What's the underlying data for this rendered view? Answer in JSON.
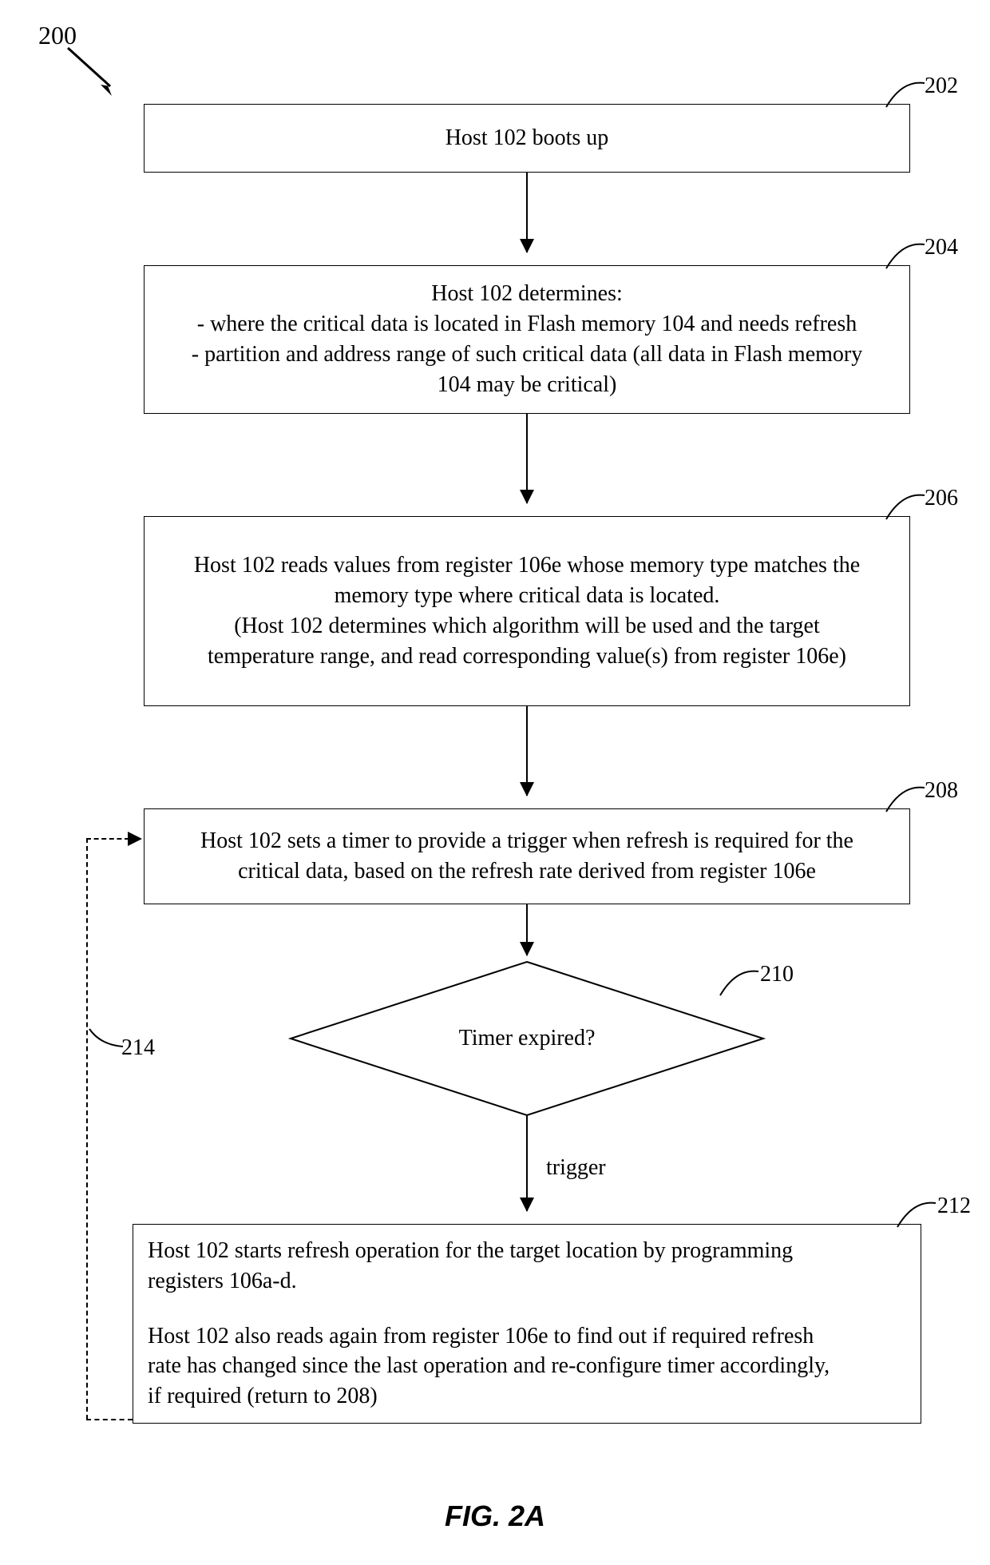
{
  "ref_label": "200",
  "figure_title": "FIG. 2A",
  "steps": {
    "s202": {
      "num": "202",
      "text": "Host 102 boots up"
    },
    "s204": {
      "num": "204",
      "l1": "Host 102 determines:",
      "l2": "- where the critical data is located in Flash memory 104 and needs refresh",
      "l3": "- partition and address range of such critical data (all data in Flash memory",
      "l4": "104 may be critical)"
    },
    "s206": {
      "num": "206",
      "l1": "Host 102 reads values from register 106e whose memory type matches the",
      "l2": "memory type where critical data is located.",
      "l3": "(Host 102 determines which algorithm will be used and the target",
      "l4": "temperature range, and read corresponding value(s) from register 106e)"
    },
    "s208": {
      "num": "208",
      "l1": "Host 102 sets a timer to provide a trigger when refresh is required for the",
      "l2": "critical data, based on the refresh rate derived from register 106e"
    },
    "s210": {
      "num": "210",
      "text": "Timer expired?"
    },
    "s212": {
      "num": "212",
      "l1": "Host 102 starts refresh operation for the target location by programming",
      "l2": "registers 106a-d.",
      "l3": "Host 102 also reads again from register 106e to find out if required refresh",
      "l4": "rate has changed since the last operation and re-configure timer accordingly,",
      "l5": "if required (return to 208)"
    },
    "s214": {
      "num": "214"
    }
  },
  "edge": {
    "trigger": "trigger"
  },
  "chart_data": {
    "type": "flowchart",
    "title": "FIG. 2A",
    "ref_number": "200",
    "nodes": [
      {
        "id": "202",
        "type": "process",
        "text": "Host 102 boots up"
      },
      {
        "id": "204",
        "type": "process",
        "text": "Host 102 determines: where the critical data is located in Flash memory 104 and needs refresh; partition and address range of such critical data (all data in Flash memory 104 may be critical)"
      },
      {
        "id": "206",
        "type": "process",
        "text": "Host 102 reads values from register 106e whose memory type matches the memory type where critical data is located. (Host 102 determines which algorithm will be used and the target temperature range, and read corresponding value(s) from register 106e)"
      },
      {
        "id": "208",
        "type": "process",
        "text": "Host 102 sets a timer to provide a trigger when refresh is required for the critical data, based on the refresh rate derived from register 106e"
      },
      {
        "id": "210",
        "type": "decision",
        "text": "Timer expired?"
      },
      {
        "id": "212",
        "type": "process",
        "text": "Host 102 starts refresh operation for the target location by programming registers 106a-d. Host 102 also reads again from register 106e to find out if required refresh rate has changed since the last operation and re-configure timer accordingly, if required (return to 208)"
      }
    ],
    "edges": [
      {
        "from": "202",
        "to": "204"
      },
      {
        "from": "204",
        "to": "206"
      },
      {
        "from": "206",
        "to": "208"
      },
      {
        "from": "208",
        "to": "210"
      },
      {
        "from": "210",
        "to": "212",
        "label": "trigger"
      },
      {
        "from": "212",
        "to": "208",
        "style": "dashed",
        "ref": "214"
      }
    ]
  }
}
